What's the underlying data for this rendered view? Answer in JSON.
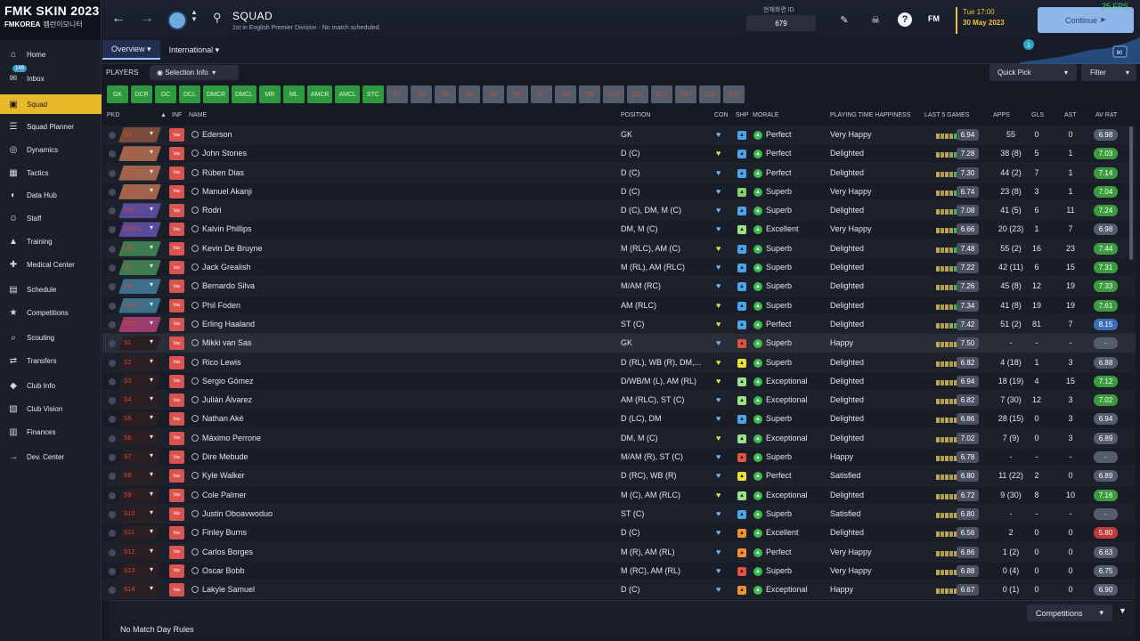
{
  "colors": {
    "accent": "#e8b92a",
    "continue": "#8fb6e8",
    "green": "#2e9a3d",
    "fps": "#46d46b"
  },
  "brand": {
    "title": "FMK SKIN 2023",
    "sub": "FMKOREA",
    "sub2": "펨런이모니터"
  },
  "sidebar": {
    "inbox_badge": "149",
    "items": [
      {
        "label": "Home",
        "icon": "home-icon"
      },
      {
        "label": "Inbox",
        "icon": "inbox-icon"
      },
      {
        "label": "Squad",
        "icon": "shirt-icon"
      },
      {
        "label": "Squad Planner",
        "icon": "planner-icon"
      },
      {
        "label": "Dynamics",
        "icon": "dynamics-icon"
      },
      {
        "label": "Tactics",
        "icon": "tactics-icon"
      },
      {
        "label": "Data Hub",
        "icon": "datahub-icon"
      },
      {
        "label": "Staff",
        "icon": "staff-icon"
      },
      {
        "label": "Training",
        "icon": "training-icon"
      },
      {
        "label": "Medical Center",
        "icon": "medical-icon"
      },
      {
        "label": "Schedule",
        "icon": "calendar-icon"
      },
      {
        "label": "Competitions",
        "icon": "trophy-icon"
      },
      {
        "label": "Scouting",
        "icon": "search-icon"
      },
      {
        "label": "Transfers",
        "icon": "transfer-icon"
      },
      {
        "label": "Club Info",
        "icon": "shield-icon"
      },
      {
        "label": "Club Vision",
        "icon": "vision-icon"
      },
      {
        "label": "Finances",
        "icon": "finance-icon"
      },
      {
        "label": "Dev. Center",
        "icon": "dev-icon"
      }
    ]
  },
  "header": {
    "title": "SQUAD",
    "subtitle": "1st in English Premier Division - No match scheduled.",
    "tabs": [
      "Overview",
      "International"
    ],
    "code_label": "현재화면 ID",
    "code_value": "679",
    "fm": "FM",
    "time": "Tue 17:00",
    "date": "30 May 2023",
    "continue": "Continue",
    "fps": "25 FPS",
    "notif": "1",
    "opp": "80"
  },
  "toolbar": {
    "players": "PLAYERS",
    "selection_info": "Selection Info",
    "quick_pick": "Quick Pick",
    "filter": "Filter"
  },
  "chips": {
    "on": [
      "GK",
      "DCR",
      "DC",
      "DCL",
      "DMCR",
      "DMCL",
      "MR",
      "ML",
      "AMCR",
      "AMCL",
      "STC"
    ],
    "off": [
      "S1",
      "S2",
      "S3",
      "S4",
      "S5",
      "S6",
      "S7",
      "S8",
      "S9",
      "S10",
      "S11",
      "S12",
      "S13",
      "S14",
      "S15"
    ]
  },
  "columns": {
    "pkd": "PKD",
    "inf": "INF",
    "name": "NAME",
    "position": "POSITION",
    "con": "CON",
    "shp": "SHP",
    "morale": "MORALE",
    "happiness": "PLAYING TIME HAPPINESS",
    "last5": "LAST 5 GAMES",
    "apps": "APPS",
    "gls": "GLS",
    "ast": "AST",
    "avrat": "AV RAT"
  },
  "players": [
    {
      "pkd": "GK",
      "name": "Ederson",
      "position": "GK",
      "morale": "Perfect",
      "happy": "Very Happy",
      "rating": "6.94",
      "apps": "55",
      "gls": "0",
      "ast": "0",
      "avrat": "6.98"
    },
    {
      "pkd": "DCR",
      "name": "John Stones",
      "position": "D (C)",
      "morale": "Perfect",
      "happy": "Delighted",
      "rating": "7.28",
      "apps": "38 (8)",
      "gls": "5",
      "ast": "1",
      "avrat": "7.03"
    },
    {
      "pkd": "DC",
      "name": "Rúben Dias",
      "position": "D (C)",
      "morale": "Perfect",
      "happy": "Delighted",
      "rating": "7.30",
      "apps": "44 (2)",
      "gls": "7",
      "ast": "1",
      "avrat": "7.14"
    },
    {
      "pkd": "DCL",
      "name": "Manuel Akanji",
      "position": "D (C)",
      "morale": "Superb",
      "happy": "Very Happy",
      "rating": "6.74",
      "apps": "23 (8)",
      "gls": "3",
      "ast": "1",
      "avrat": "7.04"
    },
    {
      "pkd": "DM",
      "name": "Rodri",
      "position": "D (C), DM, M (C)",
      "morale": "Superb",
      "happy": "Delighted",
      "rating": "7.08",
      "apps": "41 (5)",
      "gls": "6",
      "ast": "11",
      "avrat": "7.24"
    },
    {
      "pkd": "DMCL",
      "name": "Kalvin Phillips",
      "position": "DM, M (C)",
      "morale": "Excellent",
      "happy": "Very Happy",
      "rating": "6.66",
      "apps": "20 (23)",
      "gls": "1",
      "ast": "7",
      "avrat": "6.98"
    },
    {
      "pkd": "MR",
      "name": "Kevin De Bruyne",
      "position": "M (RLC), AM (C)",
      "morale": "Superb",
      "happy": "Delighted",
      "rating": "7.48",
      "apps": "55 (2)",
      "gls": "16",
      "ast": "23",
      "avrat": "7.44"
    },
    {
      "pkd": "ML",
      "name": "Jack Grealish",
      "position": "M (RL), AM (RLC)",
      "morale": "Superb",
      "happy": "Delighted",
      "rating": "7.22",
      "apps": "42 (11)",
      "gls": "6",
      "ast": "15",
      "avrat": "7.31"
    },
    {
      "pkd": "AM",
      "name": "Bernardo Silva",
      "position": "M/AM (RC)",
      "morale": "Superb",
      "happy": "Delighted",
      "rating": "7.26",
      "apps": "45 (8)",
      "gls": "12",
      "ast": "19",
      "avrat": "7.33"
    },
    {
      "pkd": "AMCL",
      "name": "Phil Foden",
      "position": "AM (RLC)",
      "morale": "Superb",
      "happy": "Delighted",
      "rating": "7.34",
      "apps": "41 (8)",
      "gls": "19",
      "ast": "19",
      "avrat": "7.61"
    },
    {
      "pkd": "STC",
      "name": "Erling Haaland",
      "position": "ST (C)",
      "morale": "Perfect",
      "happy": "Delighted",
      "rating": "7.42",
      "apps": "51 (2)",
      "gls": "81",
      "ast": "7",
      "avrat": "8.15"
    },
    {
      "pkd": "S1",
      "name": "Mikki van Sas",
      "position": "GK",
      "morale": "Superb",
      "happy": "Happy",
      "rating": "7.50",
      "apps": "-",
      "gls": "-",
      "ast": "-",
      "avrat": "-"
    },
    {
      "pkd": "S2",
      "name": "Rico Lewis",
      "position": "D (RL), WB (R), DM,...",
      "morale": "Superb",
      "happy": "Delighted",
      "rating": "6.82",
      "apps": "4 (18)",
      "gls": "1",
      "ast": "3",
      "avrat": "6.88"
    },
    {
      "pkd": "S3",
      "name": "Sergio Gómez",
      "position": "D/WB/M (L), AM (RL)",
      "morale": "Exceptional",
      "happy": "Delighted",
      "rating": "6.94",
      "apps": "18 (19)",
      "gls": "4",
      "ast": "15",
      "avrat": "7.12"
    },
    {
      "pkd": "S4",
      "name": "Julián Álvarez",
      "position": "AM (RLC), ST (C)",
      "morale": "Exceptional",
      "happy": "Delighted",
      "rating": "6.82",
      "apps": "7 (30)",
      "gls": "12",
      "ast": "3",
      "avrat": "7.02"
    },
    {
      "pkd": "S5",
      "name": "Nathan Aké",
      "position": "D (LC), DM",
      "morale": "Superb",
      "happy": "Delighted",
      "rating": "6.86",
      "apps": "28 (15)",
      "gls": "0",
      "ast": "3",
      "avrat": "6.94"
    },
    {
      "pkd": "S6",
      "name": "Máximo Perrone",
      "position": "DM, M (C)",
      "morale": "Exceptional",
      "happy": "Delighted",
      "rating": "7.02",
      "apps": "7 (9)",
      "gls": "0",
      "ast": "3",
      "avrat": "6.89"
    },
    {
      "pkd": "S7",
      "name": "Dire Mebude",
      "position": "M/AM (R), ST (C)",
      "morale": "Superb",
      "happy": "Happy",
      "rating": "6.78",
      "apps": "-",
      "gls": "-",
      "ast": "-",
      "avrat": "-"
    },
    {
      "pkd": "S8",
      "name": "Kyle Walker",
      "position": "D (RC), WB (R)",
      "morale": "Perfect",
      "happy": "Satisfied",
      "rating": "6.80",
      "apps": "11 (22)",
      "gls": "2",
      "ast": "0",
      "avrat": "6.89"
    },
    {
      "pkd": "S9",
      "name": "Cole Palmer",
      "position": "M (C), AM (RLC)",
      "morale": "Exceptional",
      "happy": "Delighted",
      "rating": "6.72",
      "apps": "9 (30)",
      "gls": "8",
      "ast": "10",
      "avrat": "7.16"
    },
    {
      "pkd": "S10",
      "name": "Justin Oboavwoduo",
      "position": "ST (C)",
      "morale": "Superb",
      "happy": "Satisfied",
      "rating": "6.80",
      "apps": "-",
      "gls": "-",
      "ast": "-",
      "avrat": "-"
    },
    {
      "pkd": "S11",
      "name": "Finley Burns",
      "position": "D (C)",
      "morale": "Excellent",
      "happy": "Delighted",
      "rating": "6.56",
      "apps": "2",
      "gls": "0",
      "ast": "0",
      "avrat": "5.80"
    },
    {
      "pkd": "S12",
      "name": "Carlos Borges",
      "position": "M (R), AM (RL)",
      "morale": "Perfect",
      "happy": "Very Happy",
      "rating": "6.86",
      "apps": "1 (2)",
      "gls": "0",
      "ast": "0",
      "avrat": "6.63"
    },
    {
      "pkd": "S13",
      "name": "Oscar Bobb",
      "position": "M (RC), AM (RL)",
      "morale": "Superb",
      "happy": "Very Happy",
      "rating": "6.88",
      "apps": "0 (4)",
      "gls": "0",
      "ast": "0",
      "avrat": "6.75"
    },
    {
      "pkd": "S14",
      "name": "Lakyle Samuel",
      "position": "D (C)",
      "morale": "Exceptional",
      "happy": "Happy",
      "rating": "6.67",
      "apps": "0 (1)",
      "gls": "0",
      "ast": "0",
      "avrat": "6.90"
    }
  ],
  "footer": {
    "rules": "No Match Day Rules",
    "competitions": "Competitions"
  }
}
